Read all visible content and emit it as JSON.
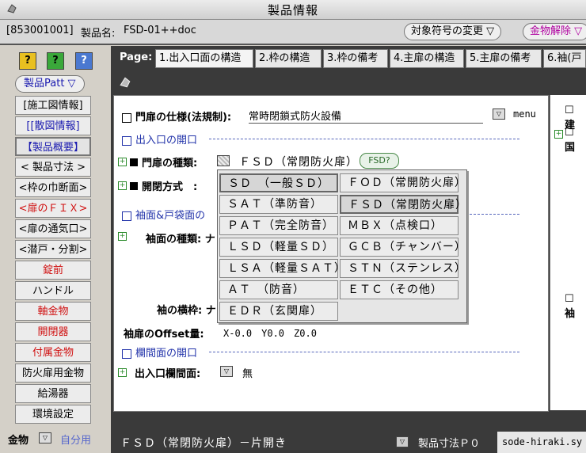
{
  "window": {
    "title": "製品情報"
  },
  "infobar": {
    "id": "[853001001]",
    "product_label": "製品名:",
    "product_name": "FSD-01++doc",
    "change_symbol": "対象符号の変更 ▽",
    "release_hardware": "金物解除 ▽"
  },
  "sidebar": {
    "help_buttons": [
      "?",
      "?",
      "?"
    ],
    "pattern_select": "製品Patt ▽",
    "items": [
      {
        "label": "[施工図情報]",
        "style": "plain"
      },
      {
        "label": "[[散図情報]",
        "style": "blue"
      },
      {
        "label": "【製品概要】",
        "style": "blue-selected"
      },
      {
        "label": "< 製品寸法 >",
        "style": "plain"
      },
      {
        "label": "<枠の巾断面>",
        "style": "plain"
      },
      {
        "label": "<扉のＦＩＸ>",
        "style": "red"
      },
      {
        "label": "<扉の通気口>",
        "style": "plain"
      },
      {
        "label": "<潜戸・分割>",
        "style": "plain"
      },
      {
        "label": "錠前",
        "style": "red"
      },
      {
        "label": "ハンドル",
        "style": "plain"
      },
      {
        "label": "軸金物",
        "style": "red"
      },
      {
        "label": "開閉器",
        "style": "red"
      },
      {
        "label": "付属金物",
        "style": "red"
      },
      {
        "label": "防火扉用金物",
        "style": "plain"
      },
      {
        "label": "給湯器",
        "style": "plain"
      },
      {
        "label": "環境設定",
        "style": "plain"
      }
    ],
    "bottom_label": "金物",
    "bottom_link": "自分用"
  },
  "tabs": {
    "page_label": "Page:",
    "items": [
      "1.出入口面の構造",
      "2.枠の構造",
      "3.枠の備考",
      "4.主扉の構造",
      "5.主扉の備考",
      "6.袖(戸"
    ]
  },
  "form": {
    "spec_label": "門扉の仕様(法規制):",
    "spec_value": "常時閉鎖式防火設備",
    "menu_label": "menu",
    "section_opening": "出入口の開口",
    "door_type_label": "門扉の種類:",
    "door_type_value": "ＦＳＤ（常閉防火扉）",
    "fsd_button": "FSD?",
    "open_method_label": "開閉方式　:",
    "section_side": "袖面&戸袋面の",
    "side_type_label": "袖面の種類: ナ",
    "side_frame_label": "袖の横枠: ナ",
    "offset_label": "袖扉のOffset量:",
    "offset_value": "X-0.0　Y0.0　Z0.0",
    "section_transom": "欄間面の開口",
    "transom_label": "出入口欄間面:",
    "transom_value": "無"
  },
  "right_panel": {
    "labels": [
      "☐ 建",
      "☐ 国",
      "☐ 袖"
    ]
  },
  "dropdown": {
    "left": [
      "ＳＤ　（一般ＳＤ）",
      "ＳＡＴ（準防音）",
      "ＰＡＴ（完全防音）",
      "ＬＳＤ（軽量ＳＤ）",
      "ＬＳＡ（軽量ＳＡＴ）",
      "ＡＴ　（防音）",
      "ＥＤＲ（玄関扉）"
    ],
    "right": [
      "ＦＯＤ（常開防火扉）",
      "ＦＳＤ（常閉防火扉）",
      "ＭＢＸ（点検口）",
      "ＧＣＢ（チャンバー）",
      "ＳＴＮ（ステンレス）",
      "ＥＴＣ（その他）"
    ],
    "highlighted": [
      "ＳＤ　（一般ＳＤ）",
      "ＦＳＤ（常閉防火扉）"
    ]
  },
  "status": {
    "left": "ＦＳＤ（常閉防火扉）－片開き",
    "middle": "製品寸法Ｐ０",
    "right": "sode-hiraki.sy"
  },
  "colors": {
    "blue": "#2233aa",
    "red": "#d01010",
    "dark": "#3a3a3a"
  }
}
